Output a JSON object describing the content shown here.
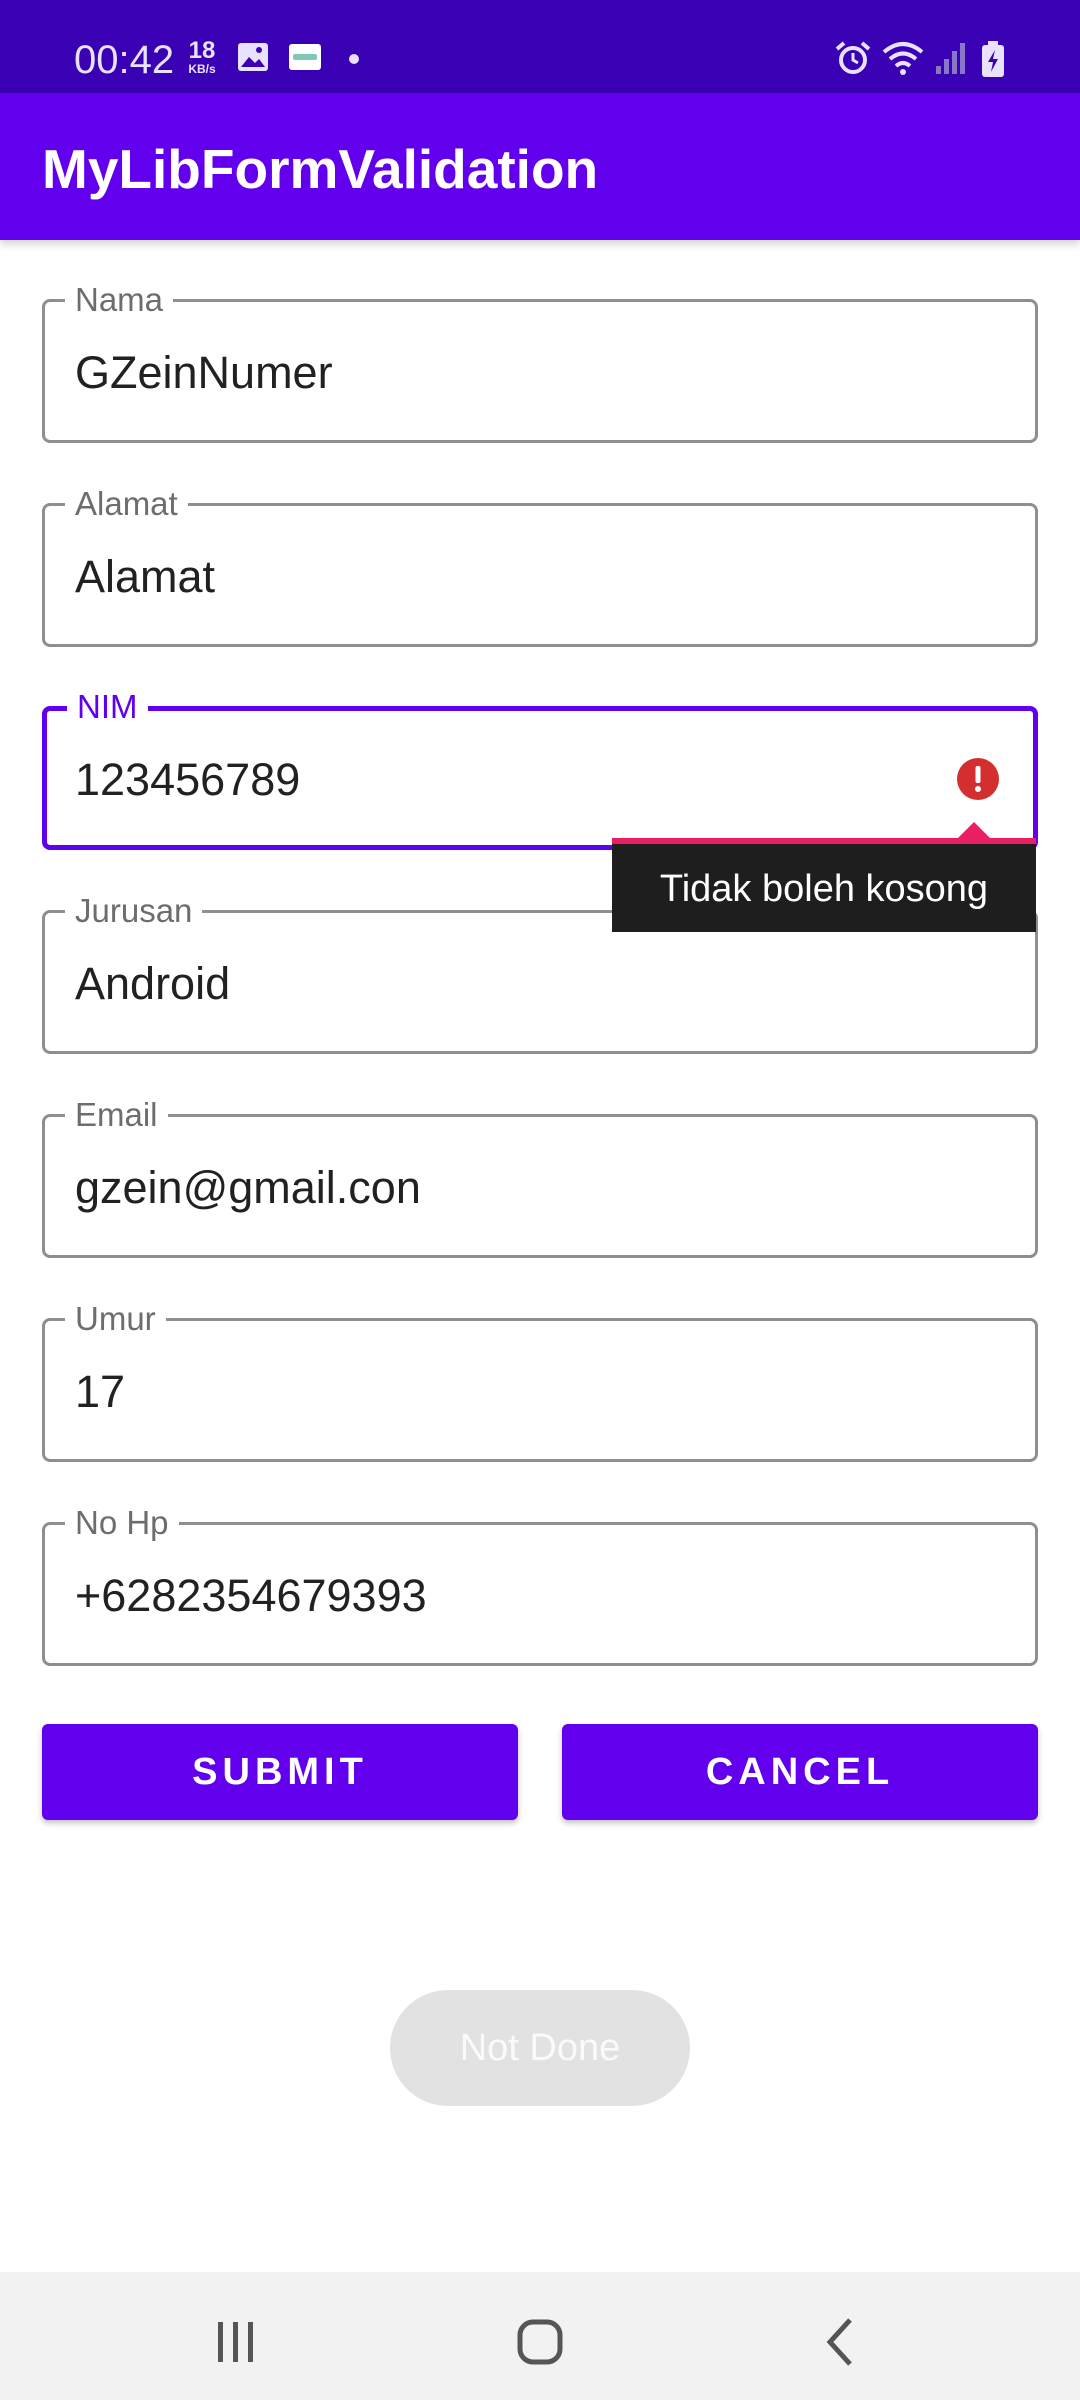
{
  "status_bar": {
    "time": "00:42",
    "net_speed_value": "18",
    "net_speed_unit": "KB/s",
    "icons": [
      "gallery-icon",
      "app-notification-icon",
      "dot-icon",
      "alarm-icon",
      "wifi-icon",
      "signal-icon",
      "battery-charging-icon"
    ]
  },
  "app_bar": {
    "title": "MyLibFormValidation"
  },
  "form": {
    "fields": [
      {
        "label": "Nama",
        "value": "GZeinNumer"
      },
      {
        "label": "Alamat",
        "value": "Alamat"
      },
      {
        "label": "NIM",
        "value": "123456789",
        "error_tooltip": "Tidak boleh kosong",
        "state": "focused"
      },
      {
        "label": "Jurusan",
        "value": "Android"
      },
      {
        "label": "Email",
        "value": "gzein@gmail.con"
      },
      {
        "label": "Umur",
        "value": "17"
      },
      {
        "label": "No Hp",
        "value": "+6282354679393"
      }
    ],
    "submit_label": "SUBMIT",
    "cancel_label": "CANCEL",
    "status_label": "Not Done"
  },
  "nav_bar": {
    "icons": [
      "recent-apps-icon",
      "home-icon",
      "back-icon"
    ]
  },
  "colors": {
    "primary": "#6200ee",
    "status_bar": "#3a00b4",
    "error_icon": "#d32f2f",
    "tooltip_background": "#1e1e1e"
  }
}
